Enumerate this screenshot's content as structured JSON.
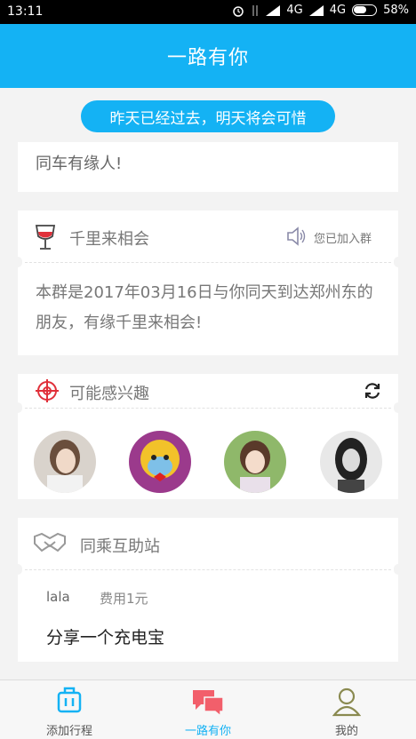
{
  "status": {
    "time": "13:11",
    "network": "4G",
    "network2": "4G",
    "battery": "58%"
  },
  "header": {
    "title": "一路有你"
  },
  "slogan": "昨天已经过去，明天将会可惜",
  "card_prev": {
    "text": "同车有缘人!"
  },
  "group_card": {
    "title": "千里来相会",
    "joined": "您已加入群",
    "body": "本群是2017年03月16日与你同天到达郑州东的朋友，有缘千里来相会!"
  },
  "interest_card": {
    "title": "可能感兴趣"
  },
  "help_card": {
    "title": "同乘互助站",
    "user": "lala",
    "fee": "费用1元",
    "post": "分享一个充电宝"
  },
  "tabs": [
    {
      "label": "添加行程"
    },
    {
      "label": "一路有你"
    },
    {
      "label": "我的"
    }
  ],
  "colors": {
    "accent": "#14b2f4",
    "active_chat": "#f25f6b"
  }
}
